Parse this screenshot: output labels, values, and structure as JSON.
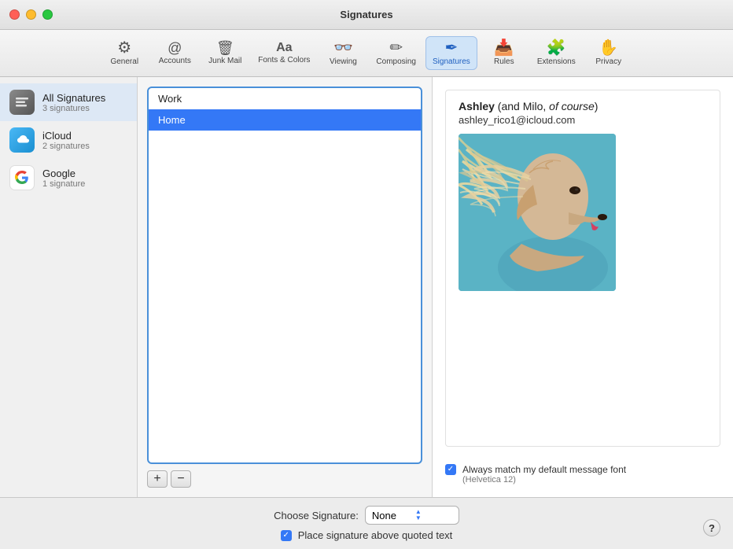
{
  "window": {
    "title": "Signatures"
  },
  "toolbar": {
    "items": [
      {
        "id": "general",
        "label": "General",
        "icon": "⚙"
      },
      {
        "id": "accounts",
        "label": "Accounts",
        "icon": "@"
      },
      {
        "id": "junk-mail",
        "label": "Junk Mail",
        "icon": "🗑"
      },
      {
        "id": "fonts-colors",
        "label": "Fonts & Colors",
        "icon": "Aa"
      },
      {
        "id": "viewing",
        "label": "Viewing",
        "icon": "∞"
      },
      {
        "id": "composing",
        "label": "Composing",
        "icon": "✏"
      },
      {
        "id": "signatures",
        "label": "Signatures",
        "icon": "✒"
      },
      {
        "id": "rules",
        "label": "Rules",
        "icon": "⬇"
      },
      {
        "id": "extensions",
        "label": "Extensions",
        "icon": "⚙"
      },
      {
        "id": "privacy",
        "label": "Privacy",
        "icon": "✋"
      }
    ]
  },
  "sidebar": {
    "items": [
      {
        "id": "all-signatures",
        "name": "All Signatures",
        "count": "3 signatures",
        "iconType": "all"
      },
      {
        "id": "icloud",
        "name": "iCloud",
        "count": "2 signatures",
        "iconType": "icloud"
      },
      {
        "id": "google",
        "name": "Google",
        "count": "1 signature",
        "iconType": "google"
      }
    ]
  },
  "signatures_list": {
    "items": [
      {
        "id": "work",
        "label": "Work",
        "selected": false
      },
      {
        "id": "home",
        "label": "Home",
        "selected": true
      }
    ],
    "add_label": "+",
    "remove_label": "−"
  },
  "preview": {
    "name_bold": "Ashley",
    "name_suffix": " (and Milo, ",
    "name_italic": "of course",
    "name_close": ")",
    "email": "ashley_rico1@icloud.com",
    "font_match_label": "Always match my default message font",
    "font_match_sub": "(Helvetica 12)"
  },
  "bottom": {
    "choose_label": "Choose Signature:",
    "choose_value": "None",
    "place_label": "Place signature above quoted text",
    "help_label": "?"
  }
}
